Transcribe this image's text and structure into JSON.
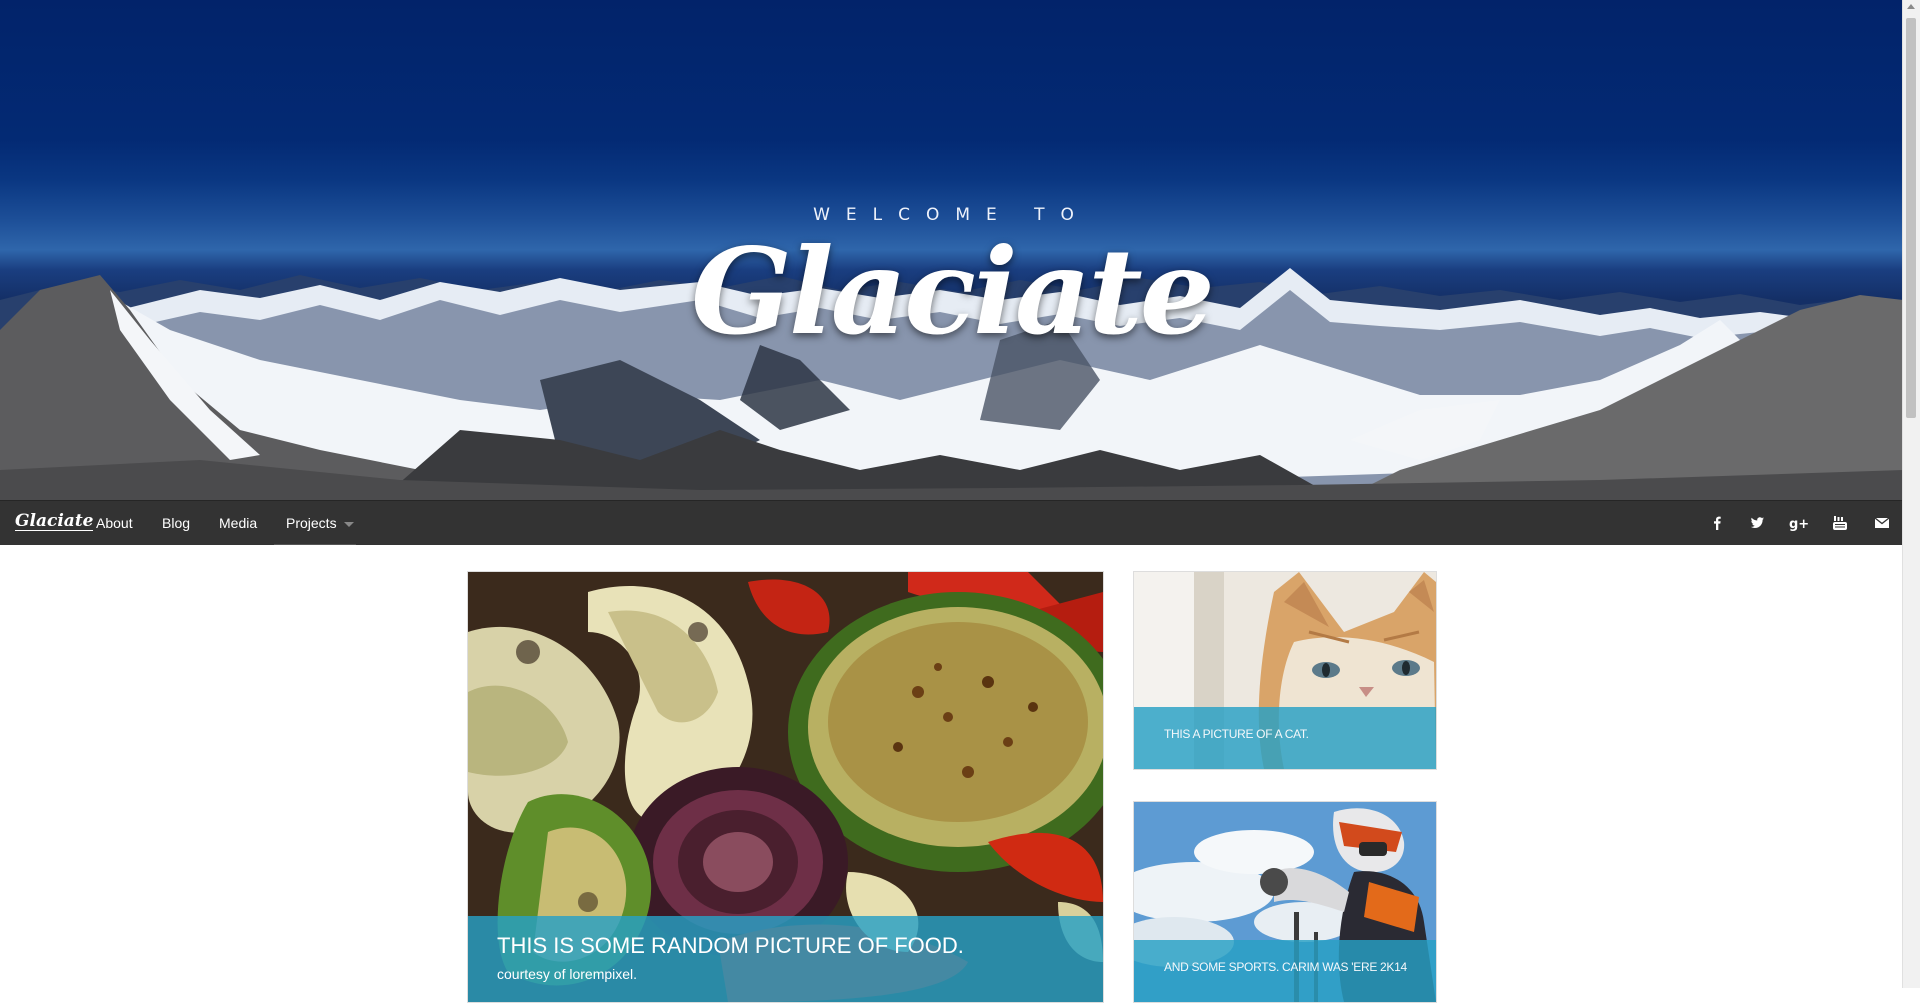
{
  "hero": {
    "welcome": "WELCOME TO",
    "title": "Glaciate"
  },
  "navbar": {
    "brand": "Glaciate",
    "items": [
      {
        "label": "About"
      },
      {
        "label": "Blog"
      },
      {
        "label": "Media"
      },
      {
        "label": "Projects"
      }
    ],
    "social_icons": [
      "facebook-icon",
      "twitter-icon",
      "google-plus-icon",
      "youtube-icon",
      "envelope-icon"
    ]
  },
  "cards": {
    "food": {
      "title": "THIS IS SOME RANDOM PICTURE OF FOOD.",
      "subtitle": "courtesy of lorempixel."
    },
    "cat": {
      "title": "THIS A PICTURE OF A CAT."
    },
    "sports": {
      "title": "AND SOME SPORTS. CARIM WAS 'ERE 2K14"
    }
  },
  "colors": {
    "navbar": "#333333",
    "caption_overlay": "#27a0c4",
    "sky": "#02236a"
  }
}
